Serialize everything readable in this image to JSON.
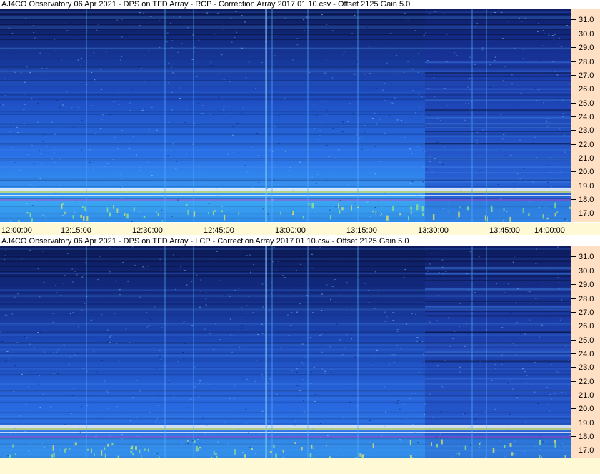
{
  "chart_data": [
    {
      "type": "heatmap",
      "title": "AJ4CO Observatory 06 Apr 2021  -  DPS on TFD Array  -  RCP  -  Correction Array 2017 01 10.csv  -  Offset 2125  Gain 5.0",
      "x_ticks": [
        "12:00:00",
        "12:15:00",
        "12:30:00",
        "12:45:00",
        "13:00:00",
        "13:15:00",
        "13:30:00",
        "13:45:00",
        "14:00:00"
      ],
      "y_ticks": [
        "31.0",
        "30.0",
        "29.0",
        "28.0",
        "27.0",
        "26.0",
        "25.0",
        "24.0",
        "23.0",
        "22.0",
        "21.0",
        "20.0",
        "19.0",
        "18.0",
        "17.0"
      ],
      "ylim": [
        16.4,
        31.8
      ],
      "grid": false,
      "colormap": [
        "#0a1850",
        "#1a3aa0",
        "#2a60d8",
        "#3a90f0",
        "#50c0f8",
        "#a0f0a0",
        "#f0f060"
      ]
    },
    {
      "type": "heatmap",
      "title": "AJ4CO Observatory 06 Apr 2021  -  DPS on TFD Array  -  LCP  -  Correction Array 2017 01 10.csv  -  Offset 2125  Gain 5.0",
      "x_ticks": [],
      "y_ticks": [
        "31.0",
        "30.0",
        "29.0",
        "28.0",
        "27.0",
        "26.0",
        "25.0",
        "24.0",
        "23.0",
        "22.0",
        "21.0",
        "20.0",
        "19.0",
        "18.0",
        "17.0"
      ],
      "ylim": [
        16.4,
        31.8
      ],
      "grid": false,
      "colormap": [
        "#0a1850",
        "#1a3aa0",
        "#2a60d8",
        "#3a90f0",
        "#50c0f8",
        "#a0f0a0",
        "#f0f060"
      ]
    }
  ]
}
